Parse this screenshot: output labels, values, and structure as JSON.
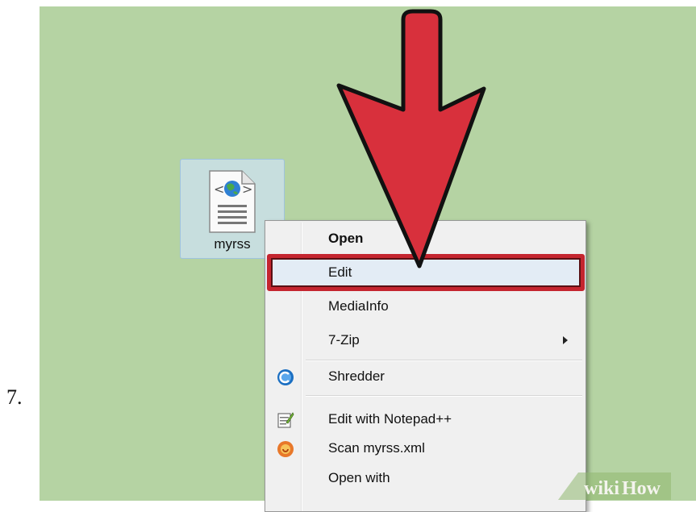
{
  "step": {
    "number": "7."
  },
  "file": {
    "name": "myrss",
    "icon": "xml-document-globe-icon"
  },
  "context_menu": {
    "items": [
      {
        "label": "Open",
        "bold": true,
        "icon": null
      },
      {
        "label": "Edit",
        "icon": null,
        "highlighted": true
      },
      {
        "label": "MediaInfo",
        "icon": null
      },
      {
        "label": "7-Zip",
        "icon": null,
        "submenu": true
      },
      {
        "label": "Shredder",
        "icon": "shredder-icon"
      },
      {
        "label": "Edit with Notepad++",
        "icon": "notepad-plus-plus-icon"
      },
      {
        "label": "Scan myrss.xml",
        "icon": "antivirus-scan-icon"
      },
      {
        "label": "Open with",
        "icon": null
      }
    ]
  },
  "annotation": {
    "arrow_color": "#d8303c",
    "highlight_color": "#c4252f"
  },
  "watermark": {
    "wiki": "wiki",
    "how": "How"
  },
  "colors": {
    "desktop": "#b5d3a3",
    "menu": "#f0f0f0"
  }
}
